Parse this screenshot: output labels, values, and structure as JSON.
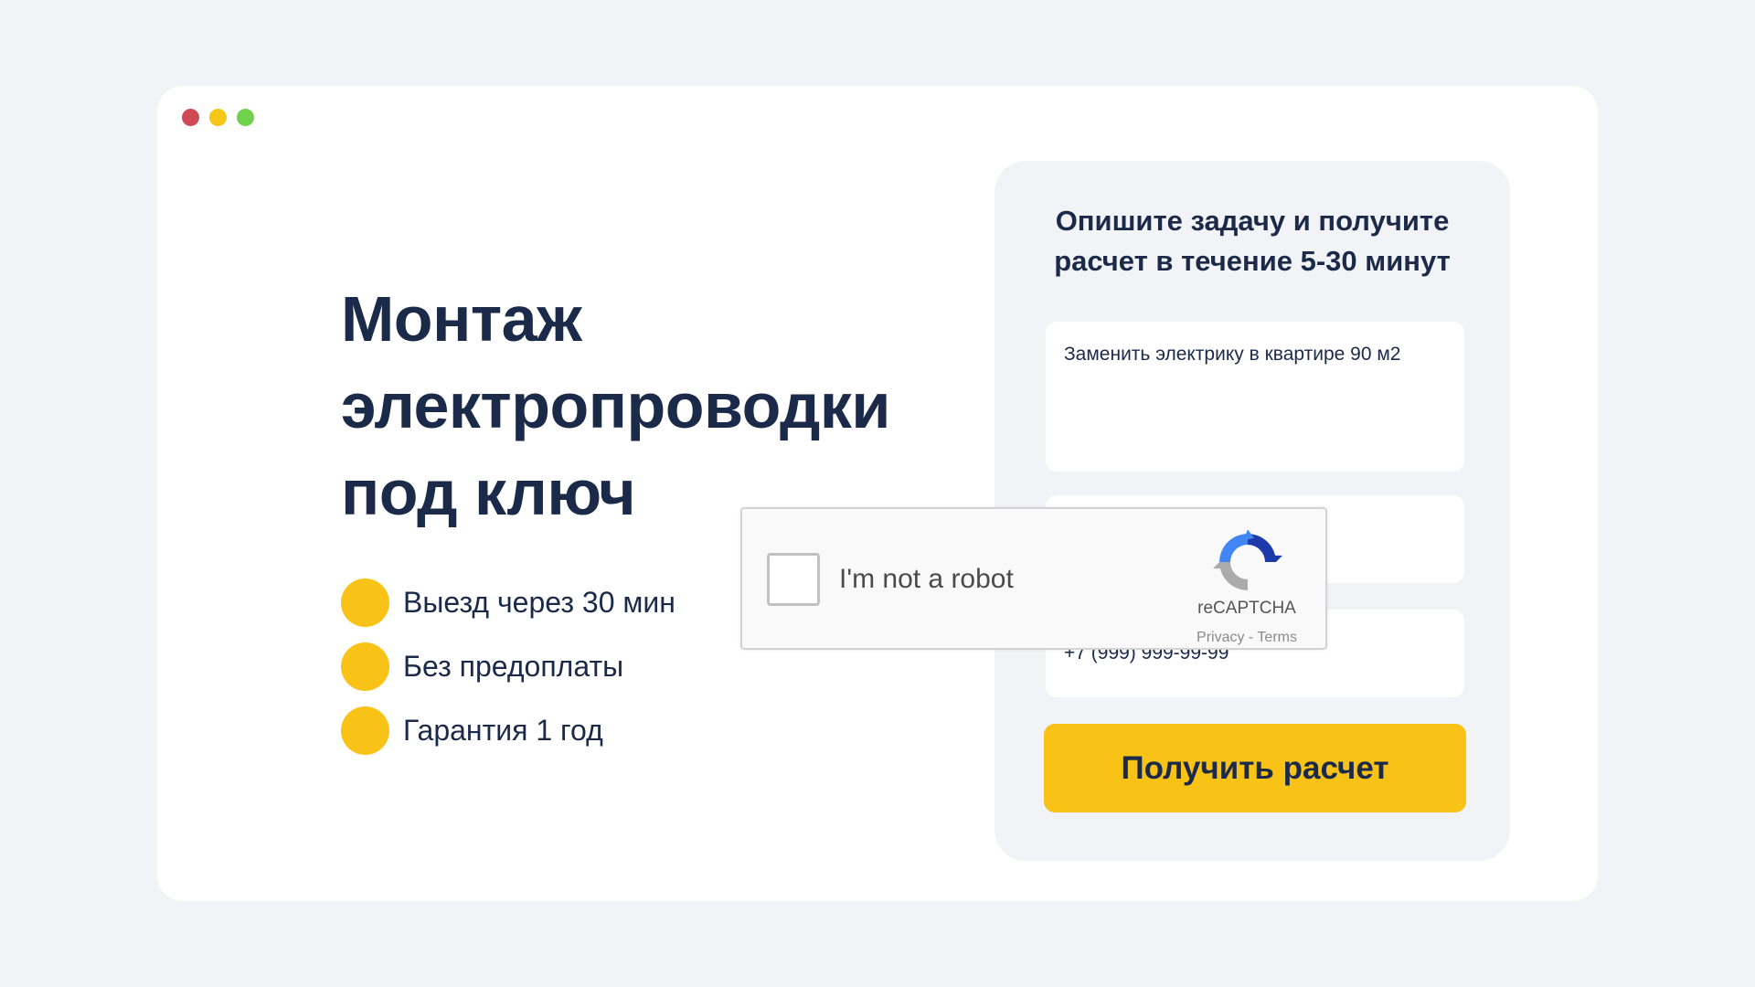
{
  "colors": {
    "dot_red": "#cf4a55",
    "dot_yellow": "#f5c518",
    "dot_green": "#6fd24a",
    "accent": "#f8c217",
    "text": "#1b2a49"
  },
  "window": {
    "controls": [
      "close-dot",
      "minimize-dot",
      "maximize-dot"
    ]
  },
  "hero": {
    "title_line1": "Монтаж",
    "title_line2": "электропроводки",
    "title_line3": "под ключ",
    "features": [
      {
        "icon": "yellow-circle-bullet",
        "text": "Выезд через 30 мин"
      },
      {
        "icon": "yellow-circle-bullet",
        "text": "Без предоплаты"
      },
      {
        "icon": "yellow-circle-bullet",
        "text": "Гарантия 1 год"
      }
    ]
  },
  "form": {
    "title_line1": "Опишите задачу и получите",
    "title_line2": "расчет в течение 5-30 минут",
    "task_value": "Заменить электрику в квартире 90 м2",
    "name_value": "",
    "phone_value": "+7 (999) 999-99-99",
    "submit_label": "Получить расчет"
  },
  "captcha": {
    "label": "I'm not a robot",
    "brand": "reCAPTCHA",
    "links": "Privacy - Terms",
    "icon": "recaptcha-logo-icon"
  }
}
